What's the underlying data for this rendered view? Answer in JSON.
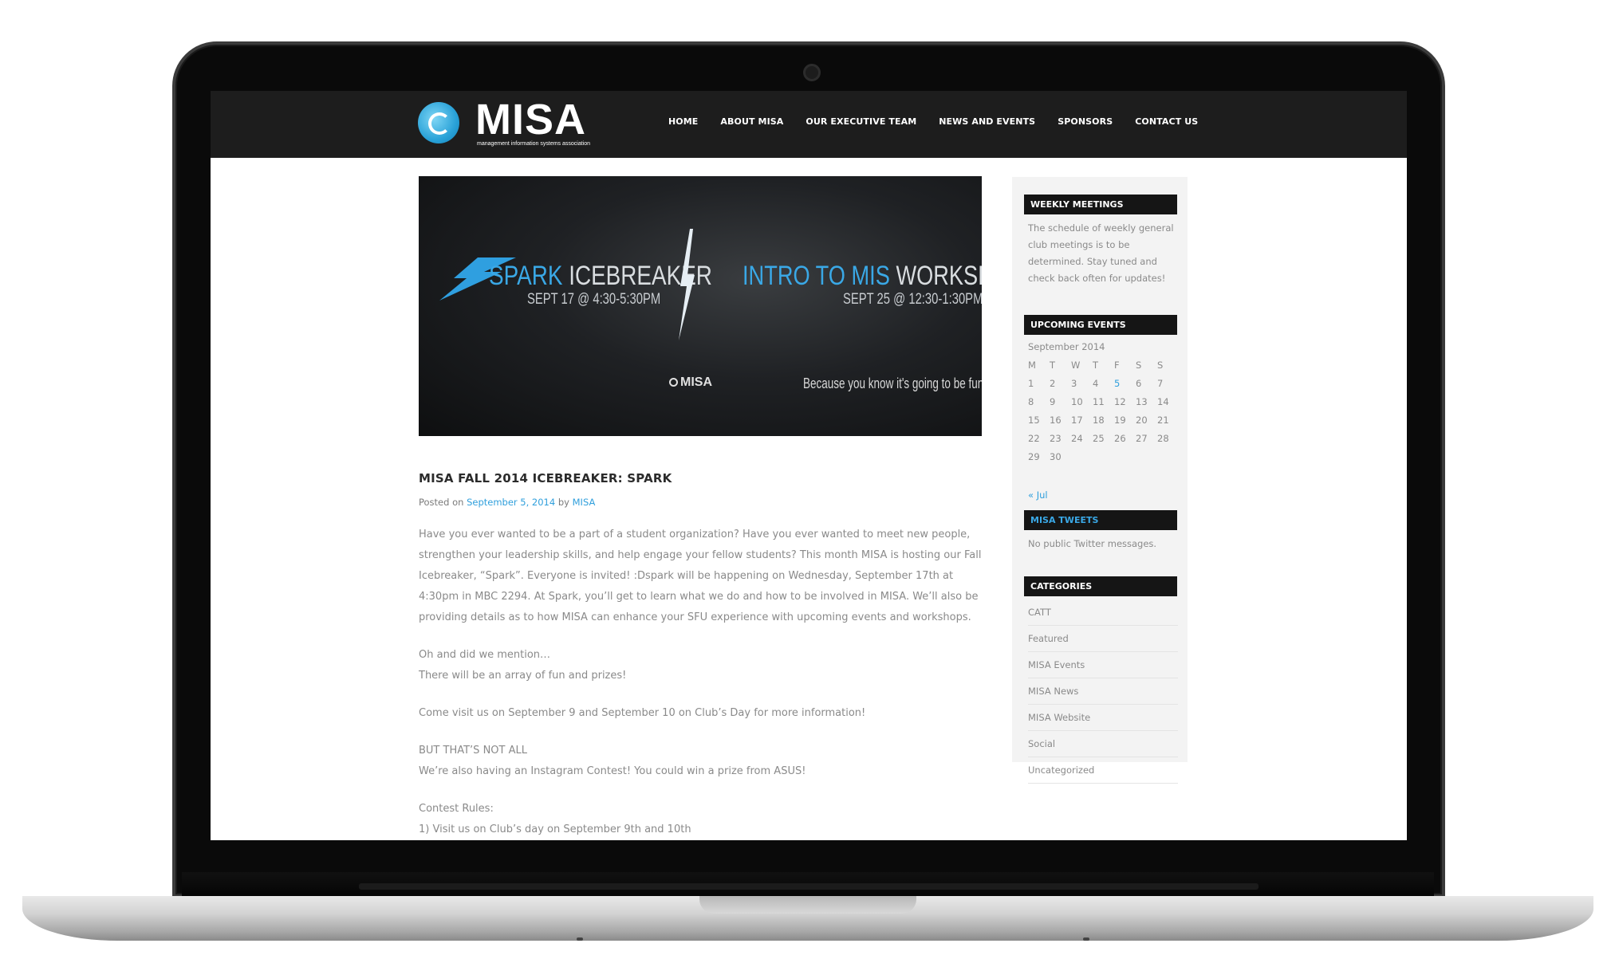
{
  "site": {
    "logo_text": "MISA",
    "logo_sub": "management information systems association"
  },
  "nav": {
    "items": [
      "HOME",
      "ABOUT MISA",
      "OUR EXECUTIVE TEAM",
      "NEWS AND EVENTS",
      "SPONSORS",
      "CONTACT US"
    ]
  },
  "banner": {
    "left_title_accent": "SPARK",
    "left_title_rest": "ICEBREAKER",
    "left_date": "SEPT 17 @ 4:30-5:30PM",
    "right_title_accent": "INTRO TO MIS",
    "right_title_rest": "WORKSHOP",
    "right_date": "SEPT 25 @ 12:30-1:30PM",
    "brand": "MISA",
    "tagline": "Because you know it's going to be fun."
  },
  "post": {
    "title": "MISA FALL 2014 ICEBREAKER: SPARK",
    "meta_prefix": "Posted on",
    "date": "September 5, 2014",
    "meta_by": "by",
    "author": "MISA",
    "p1": "Have you ever wanted to be a part of a student organization? Have you ever wanted to meet new people, strengthen your leadership skills, and help engage your fellow students? This month MISA is hosting our Fall Icebreaker, “Spark”. Everyone is invited! :Dspark will be happening on Wednesday, September 17th at 4:30pm in MBC 2294. At Spark, you’ll get to learn what we do and how to be involved in MISA. We’ll also be providing details as to how MISA can enhance your SFU experience with upcoming events and workshops.",
    "p2a": "Oh and did we mention…",
    "p2b": "There will be an array of fun and prizes!",
    "p3": "Come visit us on September 9 and September 10 on Club’s Day for more information!",
    "p4a": "BUT THAT’S NOT ALL",
    "p4b": "We’re also having an Instagram Contest! You could win a prize from ASUS!",
    "p5a": "Contest Rules:",
    "p5b": "1) Visit us on Club’s day on September 9th and 10th"
  },
  "sidebar": {
    "weekly_title": "WEEKLY MEETINGS",
    "weekly_text": "The schedule of weekly general club meetings is to be determined. Stay tuned and check back often for updates!",
    "events_title": "UPCOMING EVENTS",
    "calendar": {
      "caption": "September 2014",
      "weekdays": [
        "M",
        "T",
        "W",
        "T",
        "F",
        "S",
        "S"
      ],
      "weeks": [
        [
          "1",
          "2",
          "3",
          "4",
          "5",
          "6",
          "7"
        ],
        [
          "8",
          "9",
          "10",
          "11",
          "12",
          "13",
          "14"
        ],
        [
          "15",
          "16",
          "17",
          "18",
          "19",
          "20",
          "21"
        ],
        [
          "22",
          "23",
          "24",
          "25",
          "26",
          "27",
          "28"
        ],
        [
          "29",
          "30",
          "",
          "",
          "",
          "",
          ""
        ]
      ],
      "linked_day": "5",
      "prev_link": "« Jul"
    },
    "tweets_title": "MISA TWEETS",
    "tweets_text": "No public Twitter messages.",
    "categories_title": "CATEGORIES",
    "categories": [
      "CATT",
      "Featured",
      "MISA Events",
      "MISA News",
      "MISA Website",
      "Social",
      "Uncategorized"
    ]
  },
  "colors": {
    "accent": "#2f9fdc",
    "nav_bg": "#1d1d1d",
    "body_text": "#8a8a8a"
  }
}
